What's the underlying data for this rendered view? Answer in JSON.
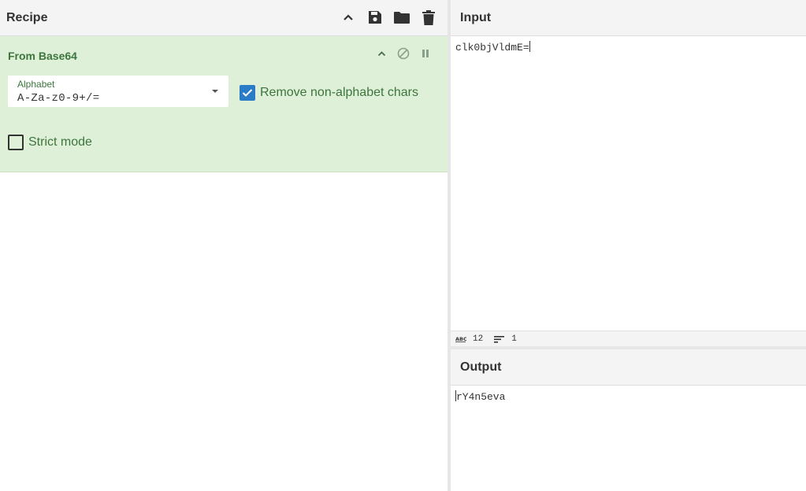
{
  "recipe": {
    "title": "Recipe",
    "header_icons": [
      "chevron-up-icon",
      "save-icon",
      "folder-icon",
      "trash-icon"
    ],
    "operation": {
      "title": "From Base64",
      "icons": [
        "chevron-up-icon",
        "disable-icon",
        "pause-icon"
      ],
      "alphabet": {
        "label": "Alphabet",
        "value": "A-Za-z0-9+/="
      },
      "remove_non_alphabet": {
        "label": "Remove non-alphabet chars",
        "checked": true
      },
      "strict_mode": {
        "label": "Strict mode",
        "checked": false
      }
    }
  },
  "input": {
    "title": "Input",
    "value": "clk0bjVldmE="
  },
  "status": {
    "length": "12",
    "lines": "1"
  },
  "output": {
    "title": "Output",
    "value": "rY4n5eva"
  },
  "colors": {
    "operation_bg": "#dff0d8",
    "operation_text": "#3c763d",
    "checkbox_accent": "#2a7cc7",
    "header_bg": "#f4f4f4"
  }
}
